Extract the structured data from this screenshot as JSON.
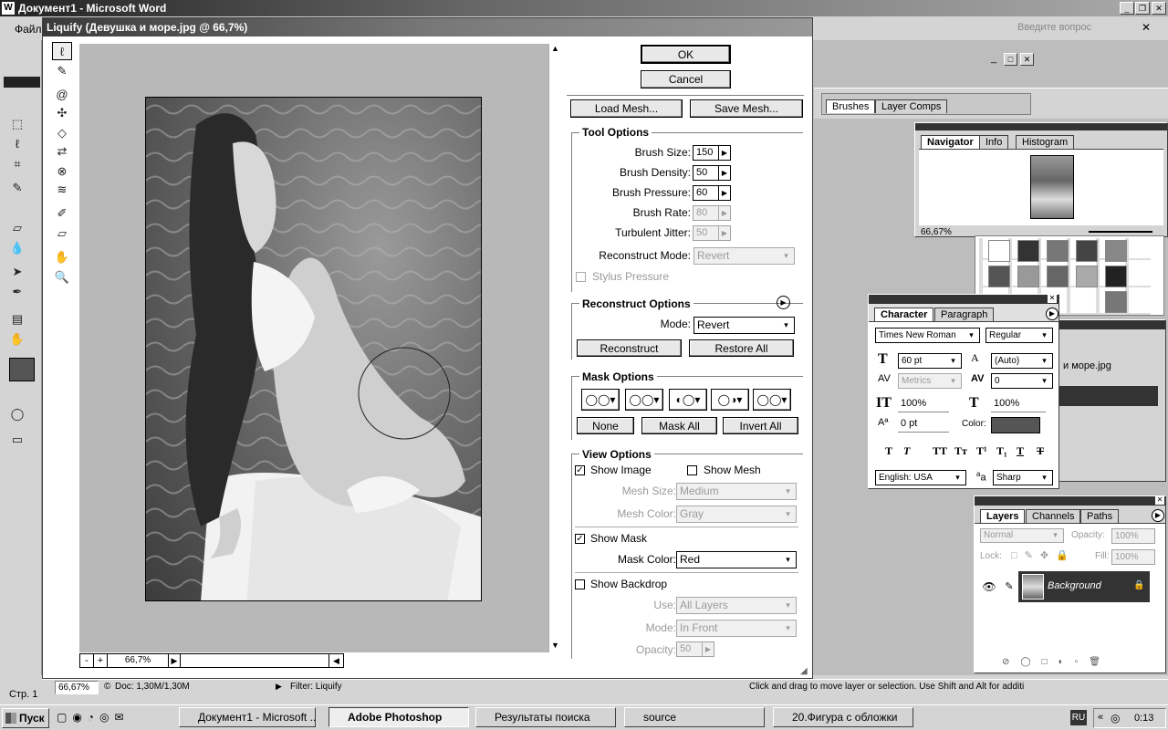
{
  "word": {
    "title": "Документ1 - Microsoft Word",
    "menu_first": "Файл",
    "question_box": "Введите вопрос"
  },
  "liquify": {
    "title": "Liquify (Девушка и море.jpg @ 66,7%)",
    "ok_label": "OK",
    "cancel_label": "Cancel",
    "load_mesh_label": "Load Mesh...",
    "save_mesh_label": "Save Mesh...",
    "zoom_value": "66,7%",
    "zoom_minus": "-",
    "zoom_plus": "+",
    "tool_options": {
      "title": "Tool Options",
      "brush_size": {
        "label": "Brush Size:",
        "value": "150"
      },
      "brush_density": {
        "label": "Brush Density:",
        "value": "50"
      },
      "brush_pressure": {
        "label": "Brush Pressure:",
        "value": "60"
      },
      "brush_rate": {
        "label": "Brush Rate:",
        "value": "80"
      },
      "turbulent_jitter": {
        "label": "Turbulent Jitter:",
        "value": "50"
      },
      "reconstruct_mode": {
        "label": "Reconstruct Mode:",
        "value": "Revert"
      },
      "stylus_pressure": "Stylus Pressure"
    },
    "reconstruct_options": {
      "title": "Reconstruct Options",
      "mode_label": "Mode:",
      "mode_value": "Revert",
      "reconstruct_label": "Reconstruct",
      "restore_all_label": "Restore All"
    },
    "mask_options": {
      "title": "Mask Options",
      "none_label": "None",
      "mask_all_label": "Mask All",
      "invert_all_label": "Invert All"
    },
    "view_options": {
      "title": "View Options",
      "show_image": "Show Image",
      "show_mesh": "Show Mesh",
      "mesh_size_label": "Mesh Size:",
      "mesh_size_value": "Medium",
      "mesh_color_label": "Mesh Color:",
      "mesh_color_value": "Gray",
      "show_mask": "Show Mask",
      "mask_color_label": "Mask Color:",
      "mask_color_value": "Red",
      "show_backdrop": "Show Backdrop",
      "use_label": "Use:",
      "use_value": "All Layers",
      "mode_label": "Mode:",
      "mode_value": "In Front",
      "opacity_label": "Opacity:",
      "opacity_value": "50"
    }
  },
  "palettes": {
    "brushes_tabs": [
      "Brushes",
      "Layer Comps"
    ],
    "navigator": {
      "tabs": [
        "Navigator",
        "Info",
        "Histogram"
      ],
      "zoom": "66,67%"
    },
    "character": {
      "tabs": [
        "Character",
        "Paragraph"
      ],
      "font_family": "Times New Roman",
      "font_style": "Regular",
      "size": "60 pt",
      "leading": "(Auto)",
      "kerning": "Metrics",
      "tracking": "0",
      "vscale": "100%",
      "hscale": "100%",
      "baseline": "0 pt",
      "color_label": "Color:",
      "language": "English: USA",
      "antialias_glyph": "a",
      "antialias_glyph_sup": "a",
      "antialias": "Sharp",
      "style_buttons": [
        "T",
        "T",
        "TT",
        "Tт",
        "T¹",
        "T₁",
        "T",
        "T"
      ]
    },
    "history_doc": "и море.jpg",
    "layers": {
      "tabs": [
        "Layers",
        "Channels",
        "Paths"
      ],
      "blend": "Normal",
      "opacity_label": "Opacity:",
      "opacity": "100%",
      "lock_label": "Lock:",
      "fill_label": "Fill:",
      "fill": "100%",
      "layer_name": "Background"
    }
  },
  "status": {
    "zoom": "66,67%",
    "doc": "Doc: 1,30M/1,30M",
    "filter": "Filter: Liquify",
    "hint": "Click and drag to move layer or selection.  Use Shift and Alt for additi"
  },
  "word_status": {
    "page": "Стр. 1"
  },
  "taskbar": {
    "start": "Пуск",
    "items": [
      "Документ1 - Microsoft ...",
      "Adobe Photoshop",
      "Результаты поиска",
      "source",
      "20.Фигура с обложки"
    ],
    "lang": "RU",
    "clock": "0:13"
  },
  "colors": {
    "titlebar": "#3a3a3a",
    "dark_panel": "#333333",
    "canvas_bg": "#b8b8b8"
  }
}
